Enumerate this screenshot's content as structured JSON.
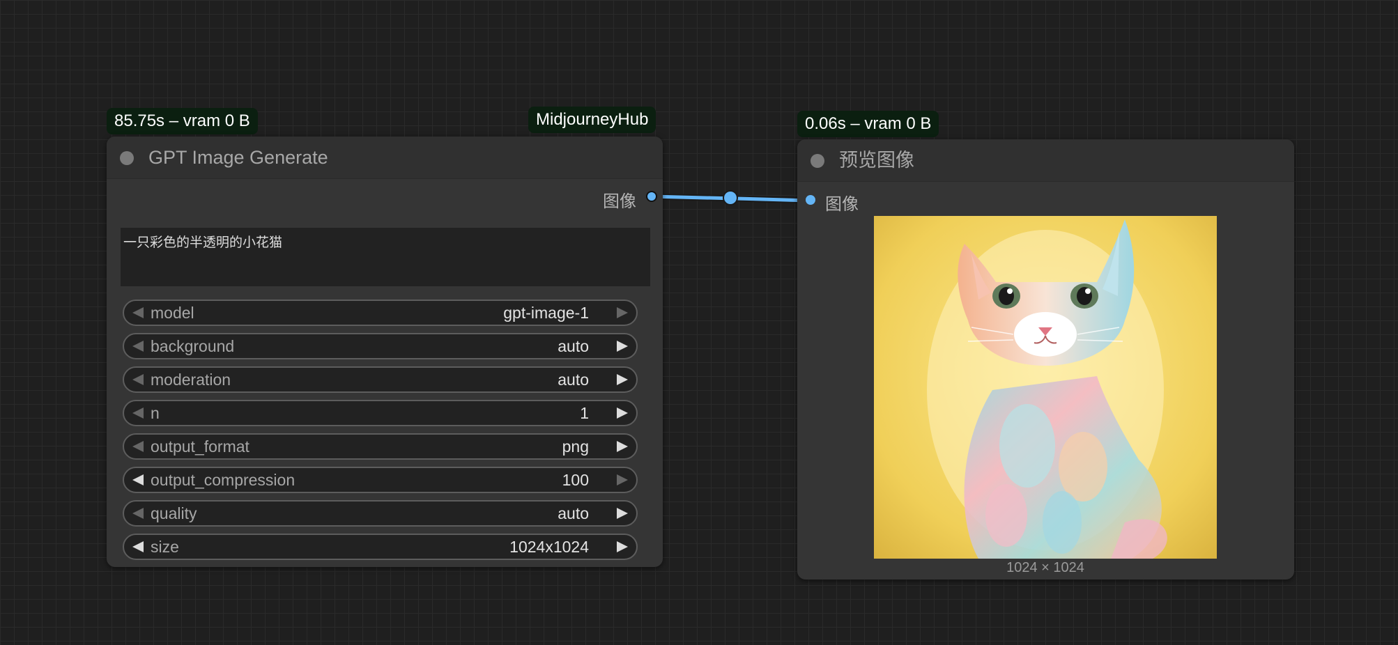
{
  "colors": {
    "canvas_bg": "#1f1f1f",
    "node_bg": "#353535",
    "badge_bg": "#0b1f10",
    "link": "#64b5f6"
  },
  "gen_node": {
    "badge": "85.75s – vram 0 B",
    "group_badge": "MidjourneyHub",
    "title": "GPT Image Generate",
    "output_label": "图像",
    "prompt": "一只彩色的半透明的小花猫",
    "widgets": [
      {
        "name": "model",
        "value": "gpt-image-1",
        "left_enabled": false,
        "right_enabled": false
      },
      {
        "name": "background",
        "value": "auto",
        "left_enabled": false,
        "right_enabled": true
      },
      {
        "name": "moderation",
        "value": "auto",
        "left_enabled": false,
        "right_enabled": true
      },
      {
        "name": "n",
        "value": "1",
        "left_enabled": false,
        "right_enabled": true
      },
      {
        "name": "output_format",
        "value": "png",
        "left_enabled": false,
        "right_enabled": true
      },
      {
        "name": "output_compression",
        "value": "100",
        "left_enabled": true,
        "right_enabled": false
      },
      {
        "name": "quality",
        "value": "auto",
        "left_enabled": false,
        "right_enabled": true
      },
      {
        "name": "size",
        "value": "1024x1024",
        "left_enabled": true,
        "right_enabled": true
      }
    ]
  },
  "preview_node": {
    "badge": "0.06s – vram 0 B",
    "title": "预览图像",
    "input_label": "图像",
    "image_caption": "1024 × 1024"
  }
}
